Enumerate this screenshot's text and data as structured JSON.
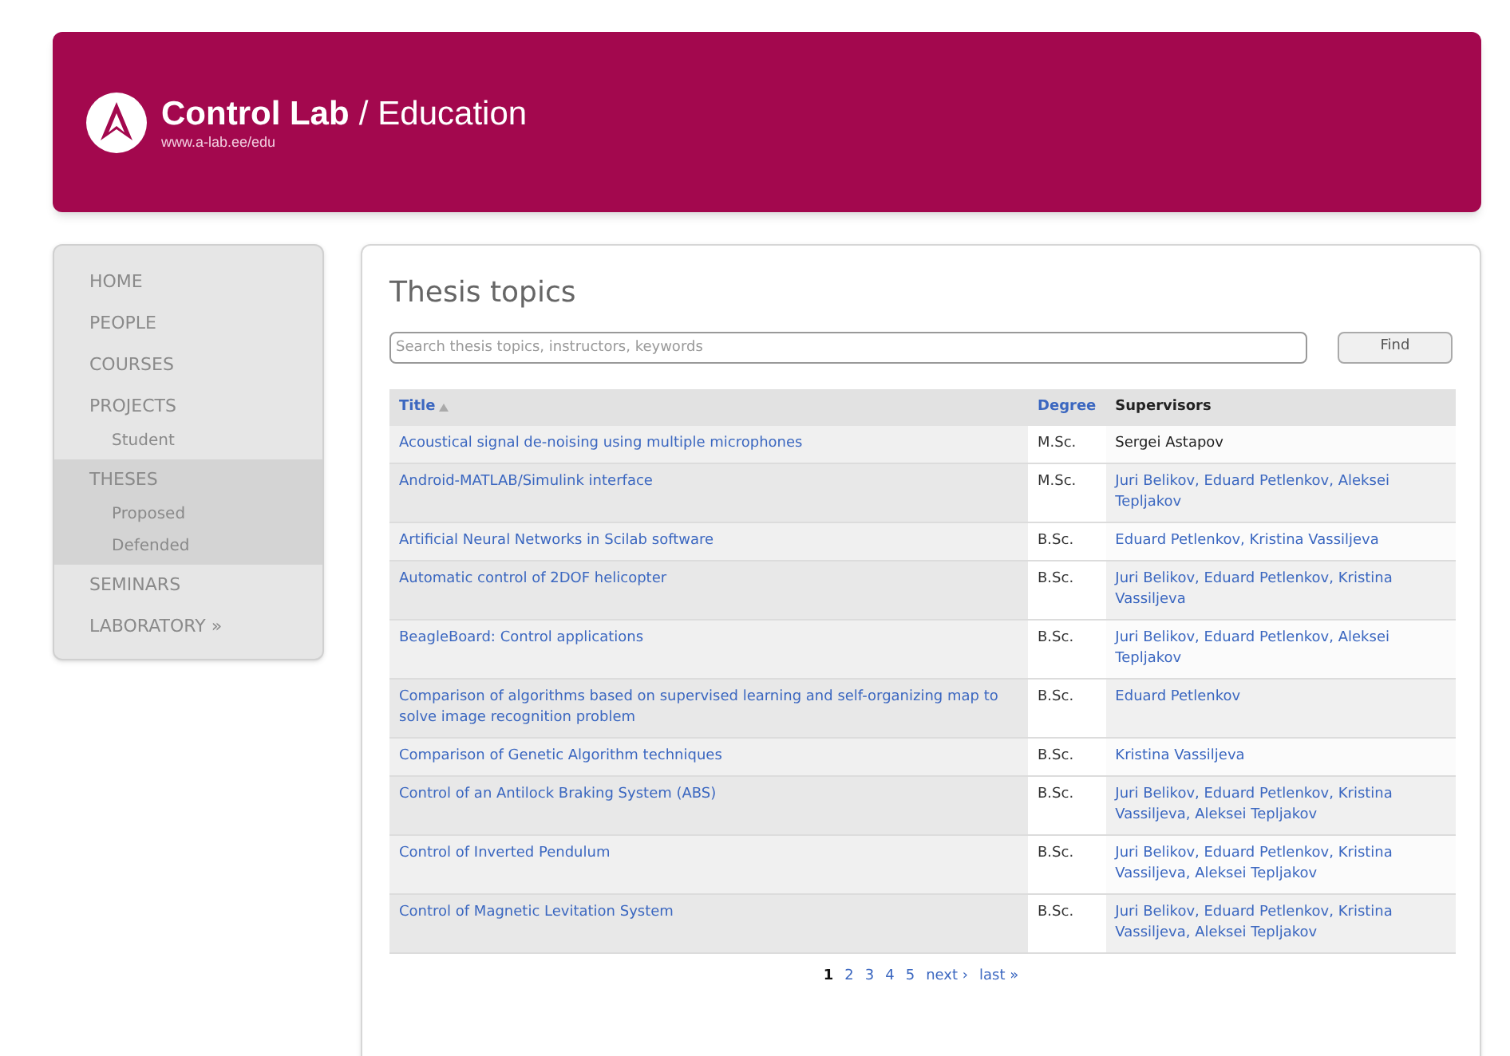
{
  "header": {
    "brand": "Control Lab",
    "separator": "/",
    "section": "Education",
    "url": "www.a-lab.ee/edu"
  },
  "sidebar": {
    "items": [
      {
        "label": "HOME",
        "selected": false
      },
      {
        "label": "PEOPLE",
        "selected": false
      },
      {
        "label": "COURSES",
        "selected": false
      },
      {
        "label": "PROJECTS",
        "selected": false,
        "children": [
          {
            "label": "Student"
          }
        ]
      },
      {
        "label": "THESES",
        "selected": true,
        "children": [
          {
            "label": "Proposed"
          },
          {
            "label": "Defended"
          }
        ]
      },
      {
        "label": "SEMINARS",
        "selected": false
      },
      {
        "label": "LABORATORY »",
        "selected": false
      }
    ]
  },
  "page": {
    "title": "Thesis topics",
    "search": {
      "placeholder": "Search thesis topics, instructors, keywords"
    },
    "find_button": "Find"
  },
  "table": {
    "columns": [
      {
        "label": "Title",
        "sorted": true,
        "link": true
      },
      {
        "label": "Degree",
        "sorted": false,
        "link": true
      },
      {
        "label": "Supervisors",
        "sorted": false,
        "link": false
      }
    ],
    "rows": [
      {
        "title": "Acoustical signal de-noising using multiple microphones",
        "degree": "M.Sc.",
        "supervisors": "Sergei Astapov",
        "linked": false
      },
      {
        "title": "Android-MATLAB/Simulink interface",
        "degree": "M.Sc.",
        "supervisors": "Juri Belikov, Eduard Petlenkov, Aleksei Tepljakov",
        "linked": true
      },
      {
        "title": "Artificial Neural Networks in Scilab software",
        "degree": "B.Sc.",
        "supervisors": "Eduard Petlenkov, Kristina Vassiljeva",
        "linked": true
      },
      {
        "title": "Automatic control of 2DOF helicopter",
        "degree": "B.Sc.",
        "supervisors": "Juri Belikov, Eduard Petlenkov, Kristina Vassiljeva",
        "linked": true
      },
      {
        "title": "BeagleBoard: Control applications",
        "degree": "B.Sc.",
        "supervisors": "Juri Belikov, Eduard Petlenkov, Aleksei Tepljakov",
        "linked": true
      },
      {
        "title": "Comparison of algorithms based on supervised learning and self-organizing map to solve image recognition problem",
        "degree": "B.Sc.",
        "supervisors": "Eduard Petlenkov",
        "linked": true
      },
      {
        "title": "Comparison of Genetic Algorithm techniques",
        "degree": "B.Sc.",
        "supervisors": "Kristina Vassiljeva",
        "linked": true
      },
      {
        "title": "Control of an Antilock Braking System (ABS)",
        "degree": "B.Sc.",
        "supervisors": "Juri Belikov, Eduard Petlenkov, Kristina Vassiljeva, Aleksei Tepljakov",
        "linked": true
      },
      {
        "title": "Control of Inverted Pendulum",
        "degree": "B.Sc.",
        "supervisors": "Juri Belikov, Eduard Petlenkov, Kristina Vassiljeva, Aleksei Tepljakov",
        "linked": true
      },
      {
        "title": "Control of Magnetic Levitation System",
        "degree": "B.Sc.",
        "supervisors": "Juri Belikov, Eduard Petlenkov, Kristina Vassiljeva, Aleksei Tepljakov",
        "linked": true
      }
    ]
  },
  "pagination": [
    {
      "label": "1",
      "selected": true
    },
    {
      "label": "2",
      "selected": false
    },
    {
      "label": "3",
      "selected": false
    },
    {
      "label": "4",
      "selected": false
    },
    {
      "label": "5",
      "selected": false
    },
    {
      "label": "next ›",
      "selected": false
    },
    {
      "label": "last »",
      "selected": false
    }
  ]
}
